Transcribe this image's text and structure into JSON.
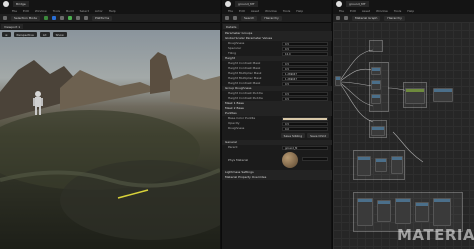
{
  "left_window": {
    "tab_title": "Bridge",
    "menu": [
      "File",
      "Edit",
      "Window",
      "Tools",
      "Build",
      "Select",
      "Actor",
      "Help"
    ],
    "toolbar": {
      "mode": "Selection Mode",
      "platforms": "Platforms"
    },
    "viewport_tab": "Viewport 1",
    "viewport_chips": [
      "Perspective",
      "Lit",
      "Show"
    ]
  },
  "middle_window": {
    "tab_title": "ground_MT",
    "menu": [
      "File",
      "Edit",
      "Asset",
      "Window",
      "Tools",
      "Help"
    ],
    "toolbar": {
      "save": "Save",
      "browse": "Browse",
      "apply": "Apply",
      "search": "Search",
      "hierarchy": "Hierarchy"
    },
    "panel_title": "Details",
    "sections": [
      {
        "header": "Parameter Groups",
        "rows": []
      },
      {
        "header": "Global Scalar Parameter Values",
        "rows": [
          {
            "label": "Roughness",
            "value": "0.5"
          },
          {
            "label": "Specular",
            "value": "0.5"
          },
          {
            "label": "Tiling",
            "value": "10.0"
          }
        ]
      },
      {
        "header": "Height",
        "rows": [
          {
            "label": "Height Contrast Mask",
            "value": "0.5"
          },
          {
            "label": "Height Contrast Mask",
            "value": "0.5"
          },
          {
            "label": "Height Multiplier Mask",
            "value": "1.269047"
          },
          {
            "label": "Height Multiplier Mask",
            "value": "1.269047"
          },
          {
            "label": "Height Contrast Mask",
            "value": "0.5"
          }
        ]
      },
      {
        "header": "Group Roughness",
        "rows": [
          {
            "label": "Height Contrast Puddle",
            "value": "0.5"
          },
          {
            "label": "Height Contrast Puddle",
            "value": "0.5"
          }
        ]
      },
      {
        "header": "Mask 1 Base",
        "rows": []
      },
      {
        "header": "Mask 2 Base",
        "rows": []
      },
      {
        "header": "Puddles",
        "rows": [
          {
            "label": "Base Color Puddle",
            "value": ""
          },
          {
            "label": "Opacity",
            "value": "0.5"
          },
          {
            "label": "Roughness",
            "value": "0.0"
          }
        ]
      }
    ],
    "buttons": {
      "save_sibling": "Save Sibling",
      "save_child": "Save Child"
    },
    "general_header": "General",
    "parent_label": "Parent",
    "parent_value": "ground_M",
    "phys_material_label": "Phys Material",
    "lightmass_header": "Lightmass Settings",
    "material_props_header": "Material Property Overrides"
  },
  "right_window": {
    "tab_title": "ground_MT",
    "menu": [
      "File",
      "Edit",
      "Asset",
      "Window",
      "Tools",
      "Help"
    ],
    "toolbar": {
      "graph_title": "Material Graph",
      "hierarchy": "Hierarchy"
    },
    "comments": [
      "UV Tiling",
      "Normal",
      "Roughness",
      "Puddles",
      "Mask 1",
      "Mask 2"
    ],
    "watermark": "MATERIAL"
  },
  "colors": {
    "background": "#101010",
    "panel": "#1b1b1b",
    "accent": "#2a6fd6",
    "node_header": "#4b6f8a",
    "wire": "#c8c8c8",
    "base_color_swatch": "#d8c8a8"
  }
}
